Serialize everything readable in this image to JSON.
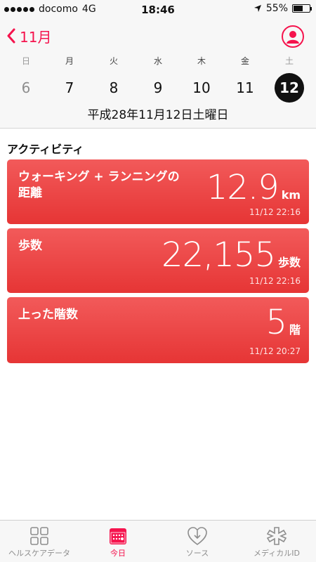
{
  "status_bar": {
    "carrier": "docomo",
    "network": "4G",
    "time": "18:46",
    "battery": "55%"
  },
  "header": {
    "back_label": "11月",
    "weekdays": [
      "日",
      "月",
      "火",
      "水",
      "木",
      "金",
      "土"
    ],
    "days": [
      "6",
      "7",
      "8",
      "9",
      "10",
      "11",
      "12"
    ],
    "selected_day": "12",
    "date_label": "平成28年11月12日土曜日"
  },
  "section": {
    "title": "アクティビティ"
  },
  "cards": [
    {
      "title": "ウォーキング + ランニングの\n距離",
      "value": "12.9",
      "unit": "km",
      "timestamp": "11/12 22:16"
    },
    {
      "title": "歩数",
      "value": "22,155",
      "unit": "歩数",
      "timestamp": "11/12 22:16"
    },
    {
      "title": "上った階数",
      "value": "5",
      "unit": "階",
      "timestamp": "11/12 20:27"
    }
  ],
  "tabs": [
    {
      "label": "ヘルスケアデータ",
      "icon": "grid-icon"
    },
    {
      "label": "今日",
      "icon": "calendar-icon"
    },
    {
      "label": "ソース",
      "icon": "download-heart-icon"
    },
    {
      "label": "メディカルID",
      "icon": "asterisk-icon"
    }
  ],
  "colors": {
    "accent": "#f5134d",
    "card": "#ea4444"
  }
}
